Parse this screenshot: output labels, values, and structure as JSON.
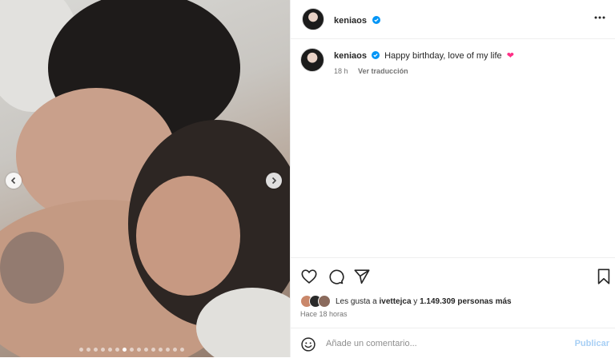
{
  "post": {
    "slide_count": 15,
    "active_slide": 7,
    "icons": {
      "prev": "chevron-left-icon",
      "next": "chevron-right-icon"
    }
  },
  "header": {
    "username": "keniaos",
    "verified_icon": "verified-badge-icon",
    "more_icon": "more-options-icon"
  },
  "caption": {
    "username": "keniaos",
    "text": "Happy birthday, love of my life",
    "emoji": "❤",
    "time": "18 h",
    "translate_label": "Ver traducción"
  },
  "actions": {
    "like_icon": "heart-icon",
    "comment_icon": "comment-icon",
    "share_icon": "send-icon",
    "save_icon": "bookmark-icon"
  },
  "likes": {
    "prefix": "Les gusta a ",
    "user": "ivettejca",
    "connector": " y ",
    "count": "1.149.309 personas más"
  },
  "timestamp": "Hace 18 horas",
  "comment": {
    "placeholder": "Añade un comentario...",
    "publish_label": "Publicar",
    "emoji_icon": "smiley-icon"
  },
  "colors": {
    "verified": "#0095f6",
    "heart": "#ff3087",
    "publish": "#a7cff5"
  }
}
